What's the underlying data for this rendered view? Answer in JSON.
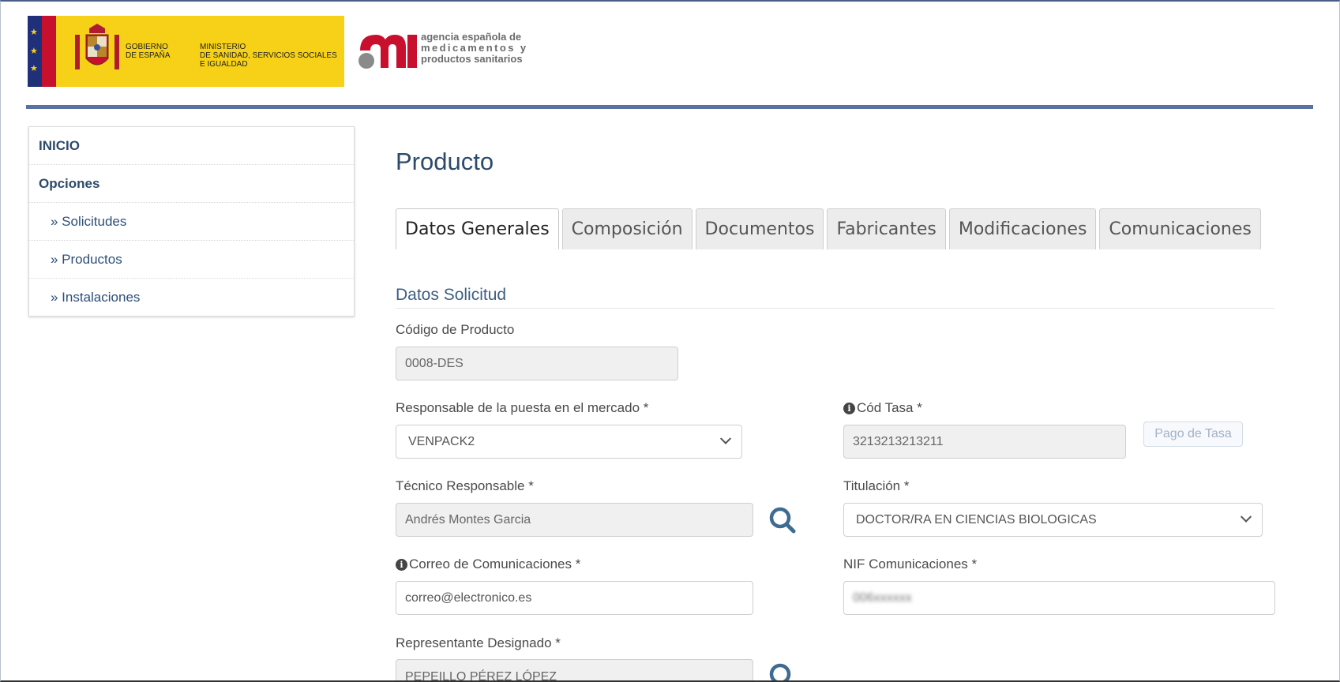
{
  "header": {
    "gov_line1": "GOBIERNO",
    "gov_line2": "DE ESPAÑA",
    "ministry_line1": "MINISTERIO",
    "ministry_line2": "DE SANIDAD, SERVICIOS SOCIALES",
    "ministry_line3": "E IGUALDAD",
    "agency_line1": "agencia española de",
    "agency_line2": "medicamentos y",
    "agency_line3": "productos sanitarios"
  },
  "sidebar": {
    "items": [
      {
        "label": "INICIO"
      },
      {
        "label": "Opciones"
      },
      {
        "label": "» Solicitudes"
      },
      {
        "label": "» Productos"
      },
      {
        "label": "» Instalaciones"
      }
    ]
  },
  "page": {
    "title": "Producto",
    "tabs": [
      {
        "label": "Datos Generales",
        "active": true
      },
      {
        "label": "Composición"
      },
      {
        "label": "Documentos"
      },
      {
        "label": "Fabricantes"
      },
      {
        "label": "Modificaciones"
      },
      {
        "label": "Comunicaciones"
      }
    ],
    "section_title": "Datos Solicitud"
  },
  "form": {
    "codigo_label": "Código de Producto",
    "codigo_value": "0008-DES",
    "responsable_label": "Responsable de la puesta en el mercado *",
    "responsable_value": "VENPACK2",
    "cod_tasa_label": "Cód Tasa *",
    "cod_tasa_value": "3213213213211",
    "pago_tasa_label": "Pago de Tasa",
    "tecnico_label": "Técnico Responsable *",
    "tecnico_value": "Andrés Montes Garcia",
    "titulacion_label": "Titulación *",
    "titulacion_value": "DOCTOR/RA EN CIENCIAS BIOLOGICAS",
    "correo_label": "Correo de Comunicaciones *",
    "correo_value": "correo@electronico.es",
    "nif_label": "NIF Comunicaciones *",
    "nif_value": "006xxxxxx",
    "representante_label": "Representante Designado *",
    "representante_value": "PEPEILLO PÉREZ LÓPEZ"
  },
  "colors": {
    "accent": "#5a72a3",
    "title": "#2c4b6b",
    "gov_yellow": "#f7d118",
    "aemps_red": "#c8102e"
  }
}
